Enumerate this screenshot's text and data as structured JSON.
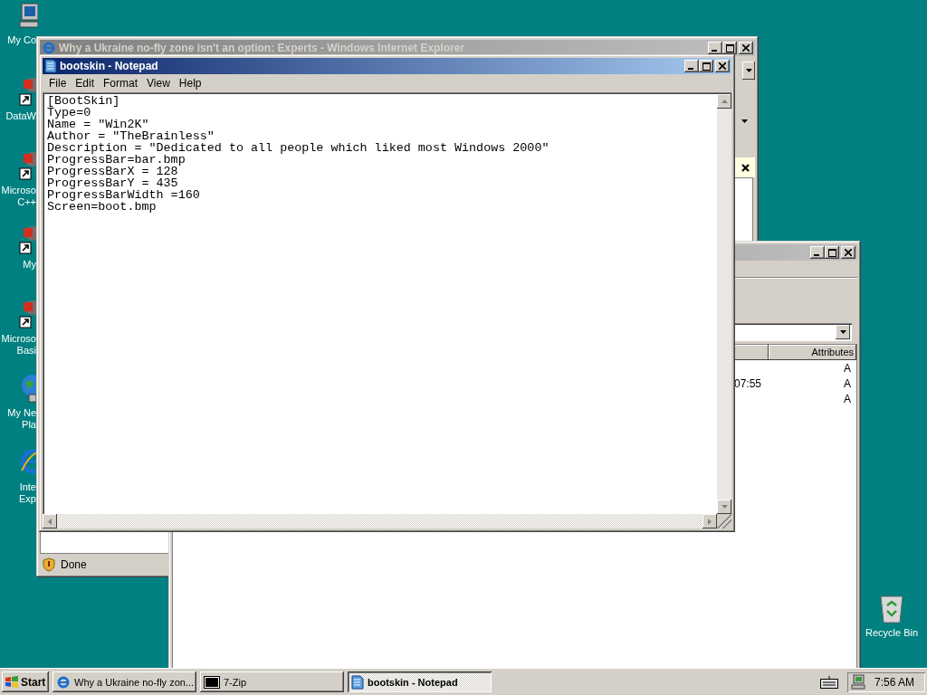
{
  "desktop_icons": [
    {
      "kind": "computer",
      "lines": [
        "My Co"
      ]
    },
    {
      "kind": "shortcut",
      "lines": [
        "DataW"
      ]
    },
    {
      "kind": "shortcut",
      "lines": [
        "Microso",
        "C++"
      ]
    },
    {
      "kind": "shortcut",
      "lines": [
        "My"
      ]
    },
    {
      "kind": "shortcut",
      "lines": [
        "Microso",
        "Basi"
      ]
    },
    {
      "kind": "network",
      "lines": [
        "My Ne",
        "Pla"
      ]
    },
    {
      "kind": "browser",
      "lines": [
        "Inte",
        "Exp"
      ]
    },
    {
      "kind": "recycle",
      "lines": [
        "Recycle Bin"
      ]
    }
  ],
  "browser_window": {
    "title": "Why a Ukraine no-fly zone isn't an option: Experts - Windows Internet Explorer",
    "active": false,
    "status": "Done"
  },
  "archive_window": {
    "active": false,
    "columns": [
      "Attributes"
    ],
    "rows": [
      {
        "attributes": "A"
      },
      {
        "column_2": "07:55",
        "attributes": "A"
      },
      {
        "attributes": "A"
      }
    ]
  },
  "notepad_window": {
    "title": "bootskin - Notepad",
    "active": true,
    "menu": [
      "File",
      "Edit",
      "Format",
      "View",
      "Help"
    ],
    "lines": [
      "[BootSkin]",
      "Type=0",
      "Name = \"Win2K\"",
      "Author = \"TheBrainless\"",
      "Description = \"Dedicated to all people which liked most Windows 2000\"",
      "ProgressBar=bar.bmp",
      "ProgressBarX = 128",
      "ProgressBarY = 435",
      "ProgressBarWidth =160",
      "Screen=boot.bmp"
    ]
  },
  "taskbar": {
    "start": "Start",
    "tasks": [
      {
        "kind": "browser",
        "label": "Why a Ukraine no-fly zon...",
        "selected": false
      },
      {
        "kind": "archive",
        "label": "7-Zip",
        "selected": false
      },
      {
        "kind": "notepad",
        "label": "bootskin - Notepad",
        "selected": true
      }
    ],
    "clock": "7:56 AM"
  }
}
